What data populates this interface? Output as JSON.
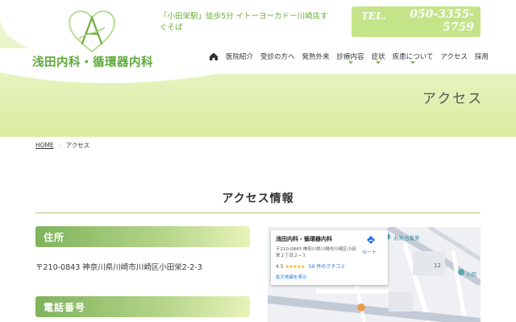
{
  "header": {
    "logo_text": "浅田内科・循環器内科",
    "station_info": "「小田栄駅」徒歩5分 イトーヨーカドー川崎店すぐそば",
    "tel_label": "TEL.",
    "tel_number": "050-3355-5759"
  },
  "nav": {
    "home_icon": "home-icon",
    "items": [
      {
        "label": "医院紹介",
        "has_submenu": false
      },
      {
        "label": "受診の方へ",
        "has_submenu": false
      },
      {
        "label": "発熱外来",
        "has_submenu": false
      },
      {
        "label": "診療内容",
        "has_submenu": true
      },
      {
        "label": "症状",
        "has_submenu": true
      },
      {
        "label": "疾患について",
        "has_submenu": true
      },
      {
        "label": "アクセス",
        "has_submenu": false
      },
      {
        "label": "採用",
        "has_submenu": false
      }
    ]
  },
  "hero": {
    "page_heading": "アクセス"
  },
  "breadcrumb": {
    "home": "HOME",
    "separator": "›",
    "current": "アクセス"
  },
  "main": {
    "section_title": "アクセス情報",
    "address_label": "住所",
    "address": "〒210-0843 神奈川県川崎市川崎区小田栄2-2-3",
    "phone_label": "電話番号"
  },
  "map": {
    "place_name": "浅田内科・循環器内科",
    "place_address": "〒210-0843 神奈川県川崎市川崎区小田栄２丁目２−３",
    "route_label": "ルート",
    "rating": "4.5",
    "stars": "★★★★★",
    "reviews": "59 件のクチコミ",
    "enlarge": "拡大地図を表示",
    "poi_1": "お弁当菓美",
    "poi_2": "小田",
    "block_number": "12"
  },
  "colors": {
    "brand_green": "#5ea83a",
    "light_green": "#c4e48a",
    "link_blue": "#1a73e8"
  }
}
